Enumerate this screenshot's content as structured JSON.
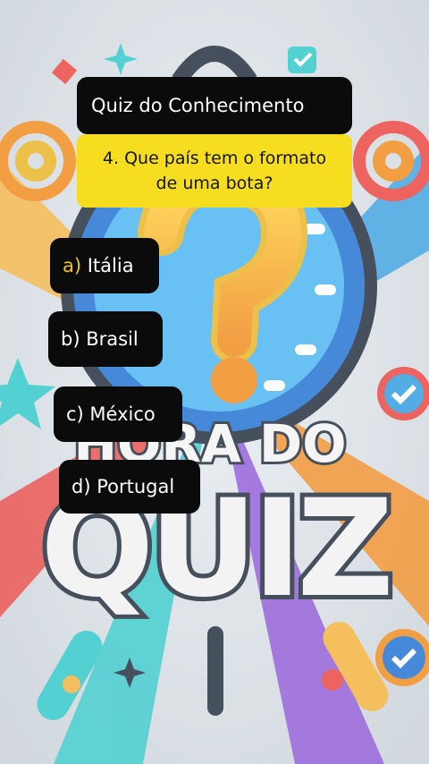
{
  "quiz": {
    "title": "Quiz do Conhecimento",
    "question": "4. Que país tem o formato de uma bota?",
    "question_line1": "4. Que país tem o formato",
    "question_line2": "de uma bota?",
    "answers": [
      {
        "letter": "a)",
        "text": " Itália",
        "highlighted": true
      },
      {
        "letter": "b)",
        "text": " Brasil",
        "highlighted": false
      },
      {
        "letter": "c)",
        "text": " México",
        "highlighted": false
      },
      {
        "letter": "d)",
        "text": " Portugal",
        "highlighted": false
      }
    ]
  },
  "background": {
    "top_text": "HORA DO",
    "big_text": "QUIZ"
  },
  "colors": {
    "question_bg": "#f6dd1f",
    "card_bg": "#0b0b0b",
    "highlight_letter": "#f0c419",
    "accent_orange": "#f08a1c",
    "accent_blue": "#1f6fd1",
    "accent_red": "#e8413c",
    "accent_teal": "#2cc6c9"
  }
}
